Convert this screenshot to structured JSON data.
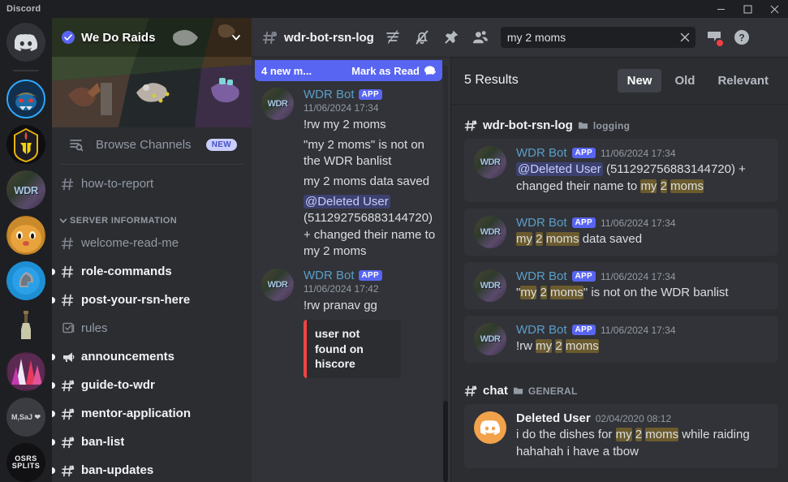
{
  "window": {
    "title": "Discord",
    "controls": {
      "minimize": "minimize-icon",
      "maximize": "maximize-icon",
      "close": "close-icon"
    }
  },
  "rail": {
    "home_label": "Discord Home",
    "servers": [
      {
        "name": "blue-dragon-server",
        "initials": ""
      },
      {
        "name": "gold-helm-server",
        "initials": ""
      },
      {
        "name": "we-do-raids",
        "initials": "WDR"
      },
      {
        "name": "orange-cat-server",
        "initials": ""
      },
      {
        "name": "blue-helm-server",
        "initials": ""
      },
      {
        "name": "bottle-server",
        "initials": ""
      },
      {
        "name": "pink-crystal-server",
        "initials": ""
      },
      {
        "name": "msaj-server",
        "initials": "M,SaJ ❤"
      },
      {
        "name": "osrs-splits-server",
        "initials": "OSRS SPLITS"
      }
    ]
  },
  "sidebar": {
    "guild_name": "We Do Raids",
    "browse_channels": {
      "label": "Browse Channels",
      "badge": "NEW"
    },
    "channels": [
      {
        "label": "how-to-report",
        "icon": "hash-icon",
        "unread": false,
        "locked": false
      },
      {
        "label": "welcome-read-me",
        "icon": "hash-icon",
        "unread": false,
        "locked": false
      },
      {
        "label": "role-commands",
        "icon": "hash-icon",
        "unread": true,
        "locked": false
      },
      {
        "label": "post-your-rsn-here",
        "icon": "hash-icon",
        "unread": true,
        "locked": false
      },
      {
        "label": "rules",
        "icon": "rules-icon",
        "unread": false,
        "locked": false
      },
      {
        "label": "announcements",
        "icon": "announcement-icon",
        "unread": true,
        "locked": false
      },
      {
        "label": "guide-to-wdr",
        "icon": "hash-lock-icon",
        "unread": true,
        "locked": true
      },
      {
        "label": "mentor-application",
        "icon": "hash-lock-icon",
        "unread": true,
        "locked": true
      },
      {
        "label": "ban-list",
        "icon": "hash-lock-icon",
        "unread": true,
        "locked": true
      },
      {
        "label": "ban-updates",
        "icon": "hash-lock-icon",
        "unread": true,
        "locked": true
      }
    ],
    "category": {
      "label": "SERVER INFORMATION"
    }
  },
  "channel_header": {
    "title": "wdr-bot-rsn-log",
    "icons": [
      "hash-lock-icon",
      "threads-icon",
      "notification-off-icon",
      "pin-icon",
      "members-icon"
    ],
    "right_icons": [
      "inbox-icon",
      "help-icon"
    ],
    "search": {
      "value": "my 2 moms",
      "placeholder": "Search",
      "clear": "clear-icon"
    }
  },
  "messages": {
    "new_banner": {
      "count": "4 new m...",
      "action": "Mark as Read"
    },
    "items": [
      {
        "author": "WDR Bot",
        "badge": "APP",
        "timestamp": "11/06/2024 17:34",
        "lines": [
          {
            "text": "!rw my 2 moms"
          },
          {
            "text": "\"my 2 moms\" is not on the WDR banlist"
          },
          {
            "text": "my 2 moms data saved"
          }
        ],
        "mention": "@Deleted User",
        "mention_tail": " (511292756883144720) + changed their name to my 2 moms"
      },
      {
        "author": "WDR Bot",
        "badge": "APP",
        "timestamp": "11/06/2024 17:42",
        "lines": [
          {
            "text": "!rw pranav gg"
          }
        ],
        "embed": "user not found on hiscore"
      }
    ]
  },
  "results": {
    "count_label": "5 Results",
    "tabs": [
      {
        "label": "New",
        "active": true
      },
      {
        "label": "Old",
        "active": false
      },
      {
        "label": "Relevant",
        "active": false
      }
    ],
    "groups": [
      {
        "channel": "wdr-bot-rsn-log",
        "category": "logging",
        "items": [
          {
            "author": "WDR Bot",
            "badge": "APP",
            "timestamp": "11/06/2024 17:34",
            "parts": [
              {
                "t": "@Deleted User",
                "k": "mention"
              },
              {
                "t": " (511292756883144720) + changed their name to ",
                "k": "plain"
              },
              {
                "t": "my",
                "k": "hl"
              },
              {
                "t": " ",
                "k": "plain"
              },
              {
                "t": "2",
                "k": "hl"
              },
              {
                "t": " ",
                "k": "plain"
              },
              {
                "t": "moms",
                "k": "hl"
              }
            ]
          },
          {
            "author": "WDR Bot",
            "badge": "APP",
            "timestamp": "11/06/2024 17:34",
            "parts": [
              {
                "t": "my",
                "k": "hl"
              },
              {
                "t": " ",
                "k": "plain"
              },
              {
                "t": "2",
                "k": "hl"
              },
              {
                "t": " ",
                "k": "plain"
              },
              {
                "t": "moms",
                "k": "hl"
              },
              {
                "t": " data saved",
                "k": "plain"
              }
            ]
          },
          {
            "author": "WDR Bot",
            "badge": "APP",
            "timestamp": "11/06/2024 17:34",
            "parts": [
              {
                "t": "\"",
                "k": "plain"
              },
              {
                "t": "my",
                "k": "hl"
              },
              {
                "t": " ",
                "k": "plain"
              },
              {
                "t": "2",
                "k": "hl"
              },
              {
                "t": " ",
                "k": "plain"
              },
              {
                "t": "moms",
                "k": "hl"
              },
              {
                "t": "\" is not on the WDR banlist",
                "k": "plain"
              }
            ]
          },
          {
            "author": "WDR Bot",
            "badge": "APP",
            "timestamp": "11/06/2024 17:34",
            "parts": [
              {
                "t": "!rw ",
                "k": "plain"
              },
              {
                "t": "my",
                "k": "hl"
              },
              {
                "t": " ",
                "k": "plain"
              },
              {
                "t": "2",
                "k": "hl"
              },
              {
                "t": " ",
                "k": "plain"
              },
              {
                "t": "moms",
                "k": "hl"
              }
            ]
          }
        ]
      },
      {
        "channel": "chat",
        "category": "GENERAL",
        "items": [
          {
            "author": "Deleted User",
            "badge": "",
            "timestamp": "02/04/2020 08:12",
            "avatar": "discord-orange",
            "parts": [
              {
                "t": "i do the dishes for ",
                "k": "plain"
              },
              {
                "t": "my",
                "k": "hl"
              },
              {
                "t": " ",
                "k": "plain"
              },
              {
                "t": "2",
                "k": "hl"
              },
              {
                "t": " ",
                "k": "plain"
              },
              {
                "t": "moms",
                "k": "hl"
              },
              {
                "t": " while raiding hahahah i have a tbow",
                "k": "plain"
              }
            ]
          }
        ]
      }
    ]
  },
  "colors": {
    "brand": "#5865f2",
    "highlight": "#6b5b2e",
    "bg_dark": "#1e1f22",
    "bg_sidebar": "#2b2d31",
    "bg_chat": "#313338",
    "text": "#dbdee1",
    "muted": "#949ba4",
    "author_blue": "#5b9ec9",
    "embed_red": "#ef4444"
  }
}
